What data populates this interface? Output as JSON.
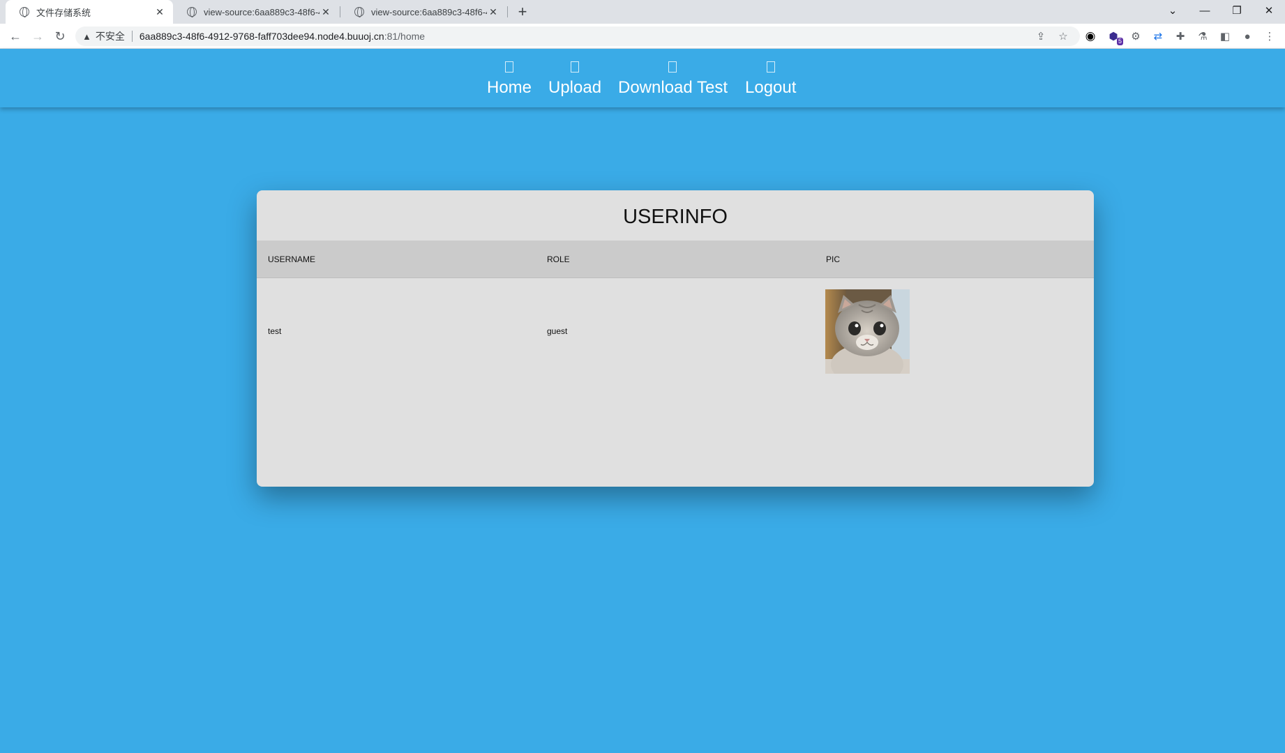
{
  "browser": {
    "tabs": [
      {
        "title": "文件存储系统",
        "active": true
      },
      {
        "title": "view-source:6aa889c3-48f6-4912-9768-faff703dee94.node4.buuoj.cn:81/home",
        "active": false
      },
      {
        "title": "view-source:6aa889c3-48f6-4912-9768-faff703dee94.node4.buuoj.cn:81/home",
        "active": false
      }
    ],
    "security_label": "不安全",
    "url_host": "6aa889c3-48f6-4912-9768-faff703dee94.node4.buuoj.cn",
    "url_path": ":81/home",
    "extension_badge": "5"
  },
  "nav": {
    "items": [
      {
        "label": "Home"
      },
      {
        "label": "Upload"
      },
      {
        "label": "Download Test"
      },
      {
        "label": "Logout"
      }
    ]
  },
  "userinfo": {
    "title": "USERINFO",
    "columns": [
      "USERNAME",
      "ROLE",
      "PIC"
    ],
    "rows": [
      {
        "username": "test",
        "role": "guest",
        "pic": "cat-photo"
      }
    ]
  },
  "colors": {
    "page_bg": "#3aabe7",
    "card_bg": "#e0e0e0",
    "header_bg": "#cbcbcb"
  }
}
